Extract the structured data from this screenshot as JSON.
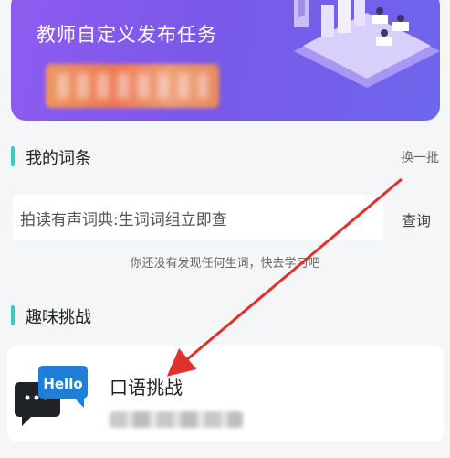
{
  "banner": {
    "title": "教师自定义发布任务"
  },
  "vocab": {
    "title": "我的词条",
    "swap_label": "换一批",
    "search_placeholder": "拍读有声词典:生词词组立即查",
    "search_button": "查询",
    "empty_hint": "你还没有发现任何生词，快去学习吧"
  },
  "challenge": {
    "title": "趣味挑战",
    "card_title": "口语挑战",
    "icon_text": "Hello"
  },
  "colors": {
    "accent": "#3fc9c2",
    "banner": "#7a58e8",
    "arrow": "#e0322a"
  }
}
